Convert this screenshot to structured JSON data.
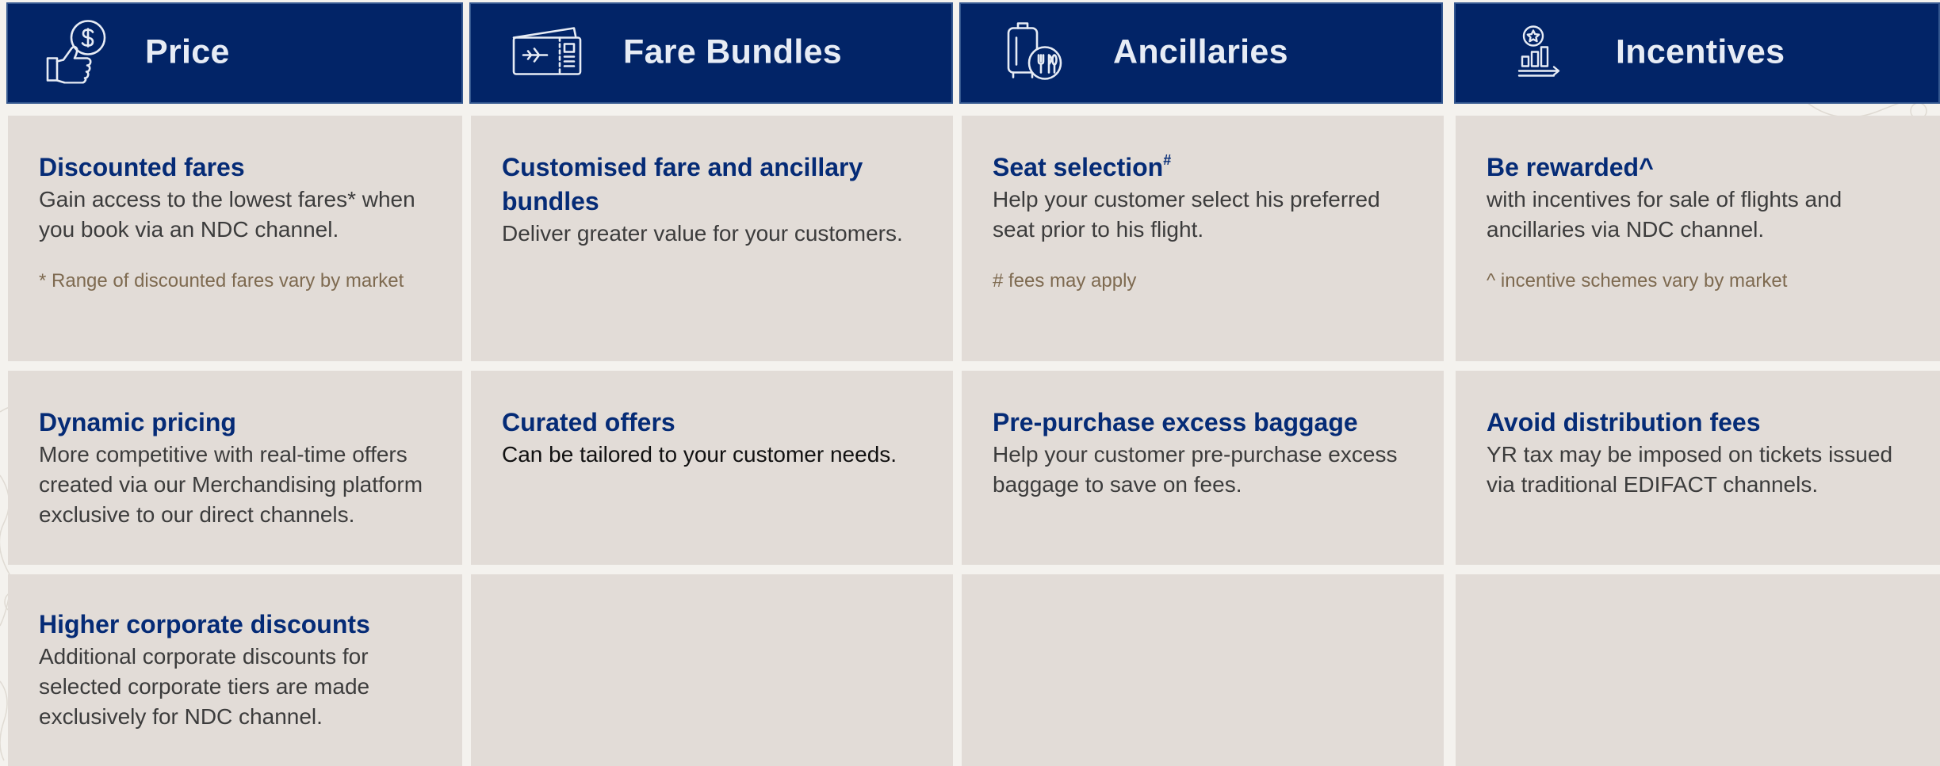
{
  "headers": [
    {
      "icon": "thumbs-up-dollar-icon",
      "title": "Price"
    },
    {
      "icon": "ticket-plane-icon",
      "title": "Fare Bundles"
    },
    {
      "icon": "luggage-cutlery-icon",
      "title": "Ancillaries"
    },
    {
      "icon": "star-chart-arrow-icon",
      "title": "Incentives"
    }
  ],
  "price": {
    "discounted": {
      "title": "Discounted fares",
      "body": "Gain access to the lowest fares* when you book via an NDC channel.",
      "note": "* Range of discounted fares vary by market"
    },
    "dynamic": {
      "title": "Dynamic pricing",
      "body": "More competitive with real-time offers created via our Merchandising platform exclusive to our direct channels."
    },
    "corporate": {
      "title": "Higher corporate discounts",
      "body": "Additional corporate discounts for selected corporate tiers are made exclusively for NDC channel."
    }
  },
  "bundles": {
    "customised": {
      "title": "Customised fare and ancillary bundles",
      "body": "Deliver greater value for your customers."
    },
    "curated": {
      "title": "Curated offers",
      "body": "Can be tailored to your customer needs."
    }
  },
  "ancillaries": {
    "seat": {
      "title": "Seat selection",
      "title_mark": "#",
      "body": "Help your customer select his preferred seat prior to his flight.",
      "note": "# fees may apply"
    },
    "baggage": {
      "title": "Pre-purchase excess baggage",
      "body": "Help your customer pre-purchase excess baggage to save on fees."
    }
  },
  "incentives": {
    "rewarded": {
      "title": "Be rewarded^",
      "body": "with incentives for sale of flights and ancillaries via NDC channel.",
      "note": "^ incentive schemes vary by market"
    },
    "fees": {
      "title": "Avoid distribution fees",
      "body": "YR tax may be imposed on tickets issued via traditional EDIFACT channels."
    }
  },
  "colors": {
    "header_bg": "#022467",
    "cell_bg": "#e2dcd7",
    "title": "#052b76",
    "note": "#7e6a50"
  }
}
